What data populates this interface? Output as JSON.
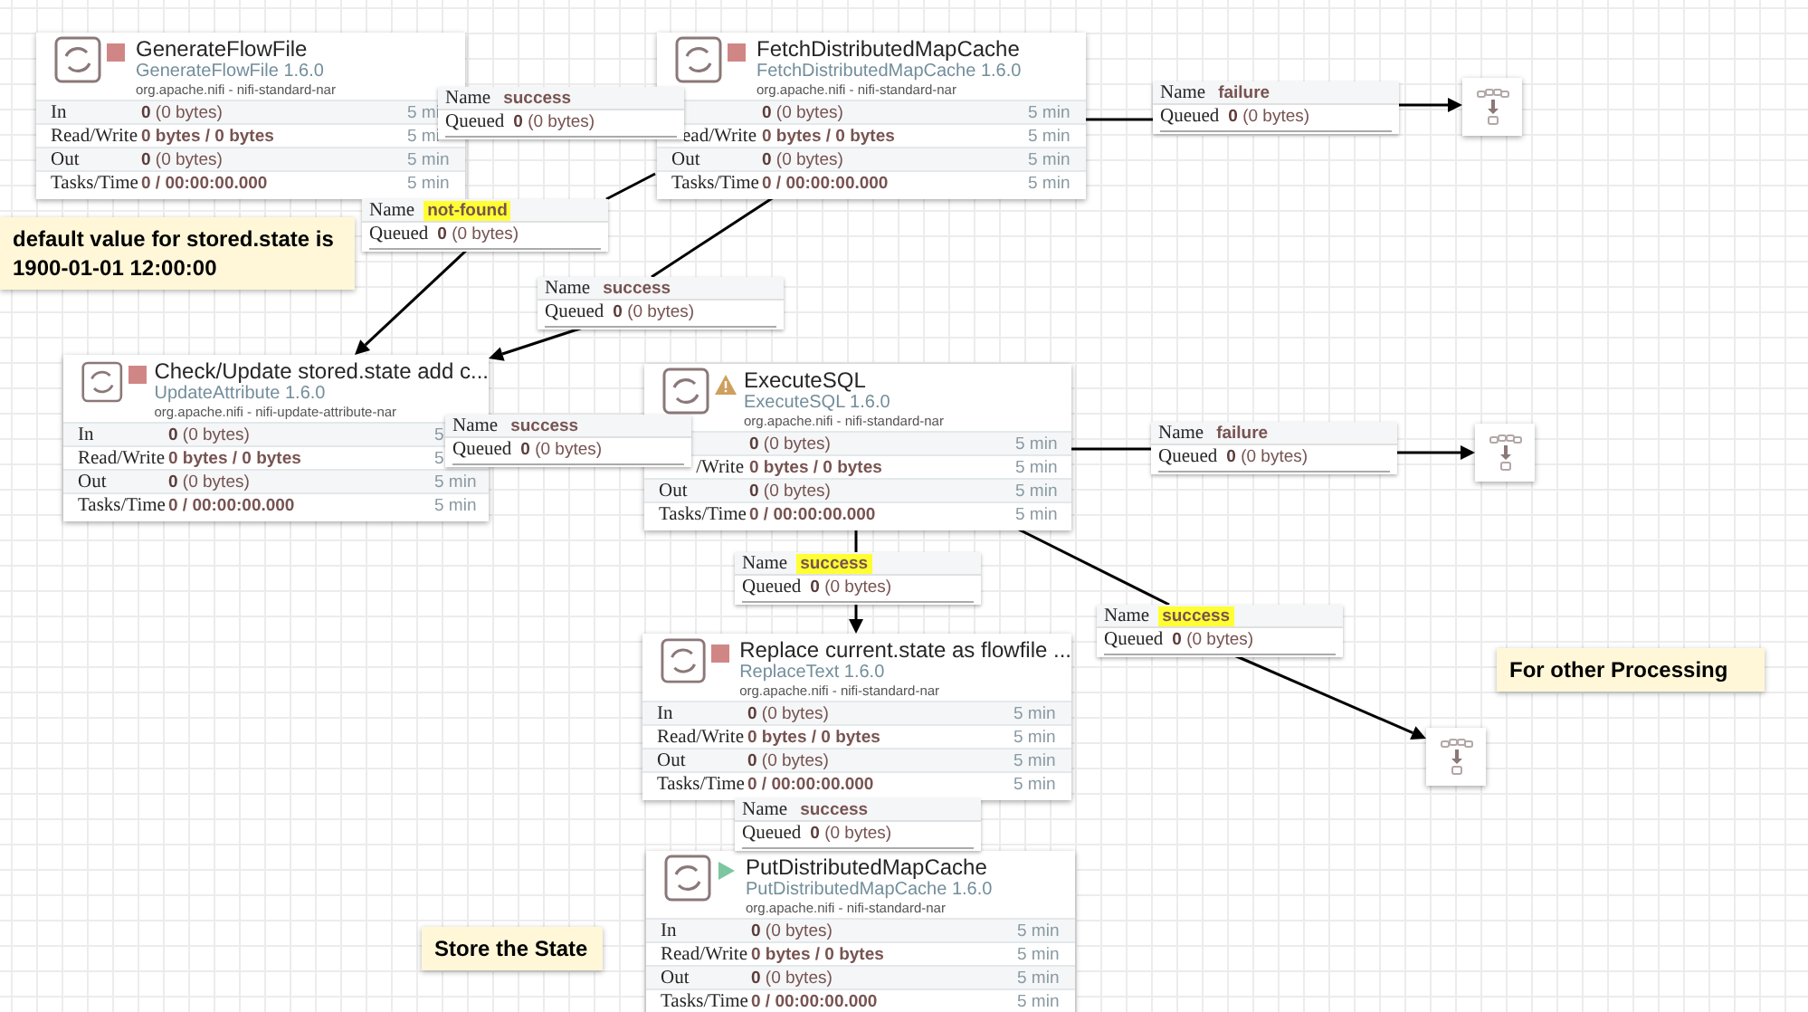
{
  "processors": [
    {
      "name": "GenerateFlowFile",
      "type": "GenerateFlowFile 1.6.0",
      "bundle": "org.apache.nifi - nifi-standard-nar",
      "running": false,
      "invalid": false,
      "rows": [
        {
          "label": "In",
          "value": "**0** (0 bytes)",
          "time": "5 mi",
          "kind": "count"
        },
        {
          "label": "Read/Write",
          "value": "0 bytes / 0 bytes",
          "time": "5 mi",
          "kind": "total"
        },
        {
          "label": "Out",
          "value": "**0** (0 bytes)",
          "time": "5 min",
          "kind": "count"
        },
        {
          "label": "Tasks/Time",
          "value": "0 / 00:00:00.000",
          "time": "5 min",
          "kind": "total"
        }
      ]
    },
    {
      "name": "FetchDistributedMapCache",
      "type": "FetchDistributedMapCache 1.6.0",
      "bundle": "org.apache.nifi - nifi-standard-nar",
      "running": false,
      "invalid": false,
      "rows": [
        {
          "value": "**0** (0 bytes)",
          "time": "5 min",
          "kind": "count"
        },
        {
          "label": "ead/Write",
          "value": "0 bytes / 0 bytes",
          "time": "5 min",
          "kind": "total-cut"
        },
        {
          "label": "Out",
          "value": "**0** (0 bytes)",
          "time": "5 min",
          "kind": "count"
        },
        {
          "label": "Tasks/Time",
          "value": "0 / 00:00:00.000",
          "time": "5 min",
          "kind": "total"
        }
      ]
    },
    {
      "name": "Check/Update stored.state add c...",
      "type": "UpdateAttribute 1.6.0",
      "bundle": "org.apache.nifi - nifi-update-attribute-nar",
      "running": false,
      "invalid": false,
      "rows": [
        {
          "label": "In",
          "value": "**0** (0 bytes)",
          "time": "5",
          "kind": "count"
        },
        {
          "label": "Read/Write",
          "value": "0 bytes / 0 bytes",
          "time": "5",
          "kind": "total"
        },
        {
          "label": "Out",
          "value": "**0** (0 bytes)",
          "time": "5 min",
          "kind": "count"
        },
        {
          "label": "Tasks/Time",
          "value": "0 / 00:00:00.000",
          "time": "5 min",
          "kind": "total"
        }
      ]
    },
    {
      "name": "ExecuteSQL",
      "type": "ExecuteSQL 1.6.0",
      "bundle": "org.apache.nifi - nifi-standard-nar",
      "running": false,
      "invalid": true,
      "rows": [
        {
          "value": "**0** (0 bytes)",
          "time": "5 min",
          "kind": "count"
        },
        {
          "label": "/Write",
          "value": "0 bytes / 0 bytes",
          "time": "5 min",
          "kind": "total-cut"
        },
        {
          "label": "Out",
          "value": "**0** (0 bytes)",
          "time": "5 min",
          "kind": "count"
        },
        {
          "label": "Tasks/Time",
          "value": "0 / 00:00:00.000",
          "time": "5 min",
          "kind": "total"
        }
      ]
    },
    {
      "name": "Replace current.state as flowfile ...",
      "type": "ReplaceText 1.6.0",
      "bundle": "org.apache.nifi - nifi-standard-nar",
      "running": false,
      "invalid": false,
      "rows": [
        {
          "label": "In",
          "value": "**0** (0 bytes)",
          "time": "5 min",
          "kind": "count"
        },
        {
          "label": "Read/Write",
          "value": "0 bytes / 0 bytes",
          "time": "5 min",
          "kind": "total"
        },
        {
          "label": "Out",
          "value": "**0** (0 bytes)",
          "time": "5 min",
          "kind": "count"
        },
        {
          "label": "Tasks/Time",
          "value": "0 / 00:00:00.000",
          "time": "5 min",
          "kind": "total"
        }
      ]
    },
    {
      "name": "PutDistributedMapCache",
      "type": "PutDistributedMapCache 1.6.0",
      "bundle": "org.apache.nifi - nifi-standard-nar",
      "running": true,
      "invalid": false,
      "rows": [
        {
          "label": "In",
          "value": "**0** (0 bytes)",
          "time": "5 min",
          "kind": "count"
        },
        {
          "label": "Read/Write",
          "value": "0 bytes / 0 bytes",
          "time": "5 min",
          "kind": "total"
        },
        {
          "label": "Out",
          "value": "**0** (0 bytes)",
          "time": "5 min",
          "kind": "count"
        },
        {
          "label": "Tasks/Time",
          "value": "0 / 00:00:00.000",
          "time": "5 min",
          "kind": "total"
        }
      ]
    }
  ],
  "connections": [
    {
      "name_label": "Name",
      "name": "success",
      "queued_label": "Queued",
      "queued": "**0** (0 bytes)",
      "highlighted": false
    },
    {
      "name_label": "Name",
      "name": "not-found",
      "queued_label": "Queued",
      "queued": "**0** (0 bytes)",
      "highlighted": true
    },
    {
      "name_label": "Name",
      "name": "success",
      "queued_label": "Queued",
      "queued": "**0** (0 bytes)",
      "highlighted": false
    },
    {
      "name_label": "Name",
      "name": "success",
      "queued_label": "Queued",
      "queued": "**0** (0 bytes)",
      "highlighted": false
    },
    {
      "name_label": "Name",
      "name": "failure",
      "queued_label": "Queued",
      "queued": "**0** (0 bytes)",
      "highlighted": false
    },
    {
      "name_label": "Name",
      "name": "failure",
      "queued_label": "Queued",
      "queued": "**0** (0 bytes)",
      "highlighted": false
    },
    {
      "name_label": "Name",
      "name": "success",
      "queued_label": "Queued",
      "queued": "**0** (0 bytes)",
      "highlighted": true
    },
    {
      "name_label": "Name",
      "name": "success",
      "queued_label": "Queued",
      "queued": "**0** (0 bytes)",
      "highlighted": true
    },
    {
      "name_label": "Name",
      "name": "success",
      "queued_label": "Queued",
      "queued": "**0** (0 bytes)",
      "highlighted": false
    }
  ],
  "funnels": [
    {
      "kind": "funnel"
    },
    {
      "kind": "funnel"
    },
    {
      "kind": "funnel"
    }
  ],
  "notes": [
    {
      "text": "default value for stored.state is 1900-01-01 12:00:00"
    },
    {
      "text": "For other Processing"
    },
    {
      "text": "Store the State"
    }
  ]
}
